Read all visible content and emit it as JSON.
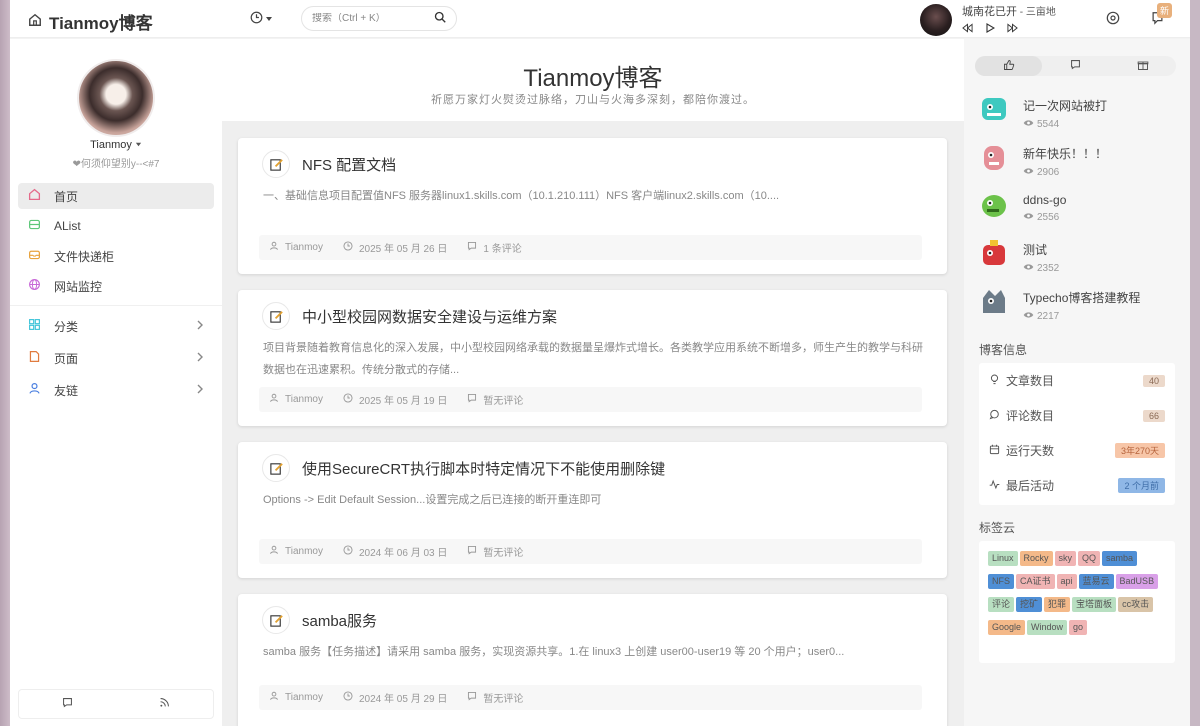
{
  "header": {
    "brand": "Tianmoy博客",
    "search_placeholder": "搜索（Ctrl + K）",
    "player": {
      "song": "城南花已开",
      "artist": "三亩地",
      "separator": " - "
    },
    "badge_new": "新"
  },
  "sidebar": {
    "username": "Tianmoy",
    "motto": "❤何须仰望别y--<#7",
    "items": [
      {
        "label": "首页",
        "icon": "home-icon",
        "color": "#e56a8a"
      },
      {
        "label": "AList",
        "icon": "drive-icon",
        "color": "#5fc77a"
      },
      {
        "label": "文件快递柜",
        "icon": "inbox-icon",
        "color": "#e8a33d"
      },
      {
        "label": "网站监控",
        "icon": "globe-icon",
        "color": "#c96ad8"
      }
    ],
    "groups": [
      {
        "label": "分类",
        "icon": "grid-icon",
        "color": "#3cc3d8"
      },
      {
        "label": "页面",
        "icon": "page-icon",
        "color": "#e07b3f"
      },
      {
        "label": "友链",
        "icon": "user-icon",
        "color": "#4a7fe0"
      }
    ]
  },
  "hero": {
    "title": "Tianmoy博客",
    "subtitle": "祈愿万家灯火熨烫过脉络，刀山与火海多深刻，都陪你渡过。"
  },
  "posts": [
    {
      "title": "NFS 配置文档",
      "excerpt": "一、基础信息项目配置值NFS 服务器linux1.skills.com（10.1.210.111）NFS 客户端linux2.skills.com（10....",
      "author": "Tianmoy",
      "date": "2025 年 05 月 26 日",
      "comments": "1 条评论"
    },
    {
      "title": "中小型校园网数据安全建设与运维方案",
      "excerpt": "项目背景随着教育信息化的深入发展，中小型校园网络承载的数据量呈爆炸式增长。各类教学应用系统不断增多，师生产生的教学与科研数据也在迅速累积。传统分散式的存储...",
      "author": "Tianmoy",
      "date": "2025 年 05 月 19 日",
      "comments": "暂无评论"
    },
    {
      "title": "使用SecureCRT执行脚本时特定情况下不能使用删除键",
      "excerpt": "Options -> Edit Default Session...设置完成之后已连接的断开重连即可",
      "author": "Tianmoy",
      "date": "2024 年 06 月 03 日",
      "comments": "暂无评论"
    },
    {
      "title": "samba服务",
      "excerpt": "samba 服务【任务描述】请采用 samba 服务，实现资源共享。1.在 linux3 上创建 user00-user19 等 20 个用户；user0...",
      "author": "Tianmoy",
      "date": "2024 年 05 月 29 日",
      "comments": "暂无评论"
    }
  ],
  "hot": [
    {
      "title": "记一次网站被打",
      "views": "5544",
      "color": "#3ec9c0"
    },
    {
      "title": "新年快乐！！！",
      "views": "2906",
      "color": "#e58f97"
    },
    {
      "title": "ddns-go",
      "views": "2556",
      "color": "#6cc24a"
    },
    {
      "title": "测试",
      "views": "2352",
      "color": "#d8383b"
    },
    {
      "title": "Typecho博客搭建教程",
      "views": "2217",
      "color": "#6c7b88"
    }
  ],
  "blog_info": {
    "heading": "博客信息",
    "rows": [
      {
        "label": "文章数目",
        "value": "40",
        "bg": "#ecd9cb",
        "fg": "#8a6a55"
      },
      {
        "label": "评论数目",
        "value": "66",
        "bg": "#ecd9cb",
        "fg": "#8a6a55"
      },
      {
        "label": "运行天数",
        "value": "3年270天",
        "bg": "#f7c6a8",
        "fg": "#b5623a"
      },
      {
        "label": "最后活动",
        "value": "2 个月前",
        "bg": "#8fb7e6",
        "fg": "#3f6ea8"
      }
    ]
  },
  "tag_cloud": {
    "heading": "标签云",
    "tags": [
      {
        "name": "Linux",
        "bg": "#b8dfc1"
      },
      {
        "name": "Rocky",
        "bg": "#f4b989"
      },
      {
        "name": "sky",
        "bg": "#f0b4b4"
      },
      {
        "name": "QQ",
        "bg": "#f0b4b4"
      },
      {
        "name": "samba",
        "bg": "#4f8fd6"
      },
      {
        "name": "NFS",
        "bg": "#4f8fd6"
      },
      {
        "name": "CA证书",
        "bg": "#f0b4b4"
      },
      {
        "name": "api",
        "bg": "#f0b4b4"
      },
      {
        "name": "蓝易云",
        "bg": "#4f8fd6"
      },
      {
        "name": "BadUSB",
        "bg": "#d9a0e8"
      },
      {
        "name": "评论",
        "bg": "#b8dfc1"
      },
      {
        "name": "挖矿",
        "bg": "#4f8fd6"
      },
      {
        "name": "犯罪",
        "bg": "#f4b989"
      },
      {
        "name": "宝塔面板",
        "bg": "#b8dfc1"
      },
      {
        "name": "cc攻击",
        "bg": "#d9c4a8"
      },
      {
        "name": "Google",
        "bg": "#f4b989"
      },
      {
        "name": "Window",
        "bg": "#b8dfc1"
      },
      {
        "name": "go",
        "bg": "#f0b4b4"
      }
    ]
  }
}
